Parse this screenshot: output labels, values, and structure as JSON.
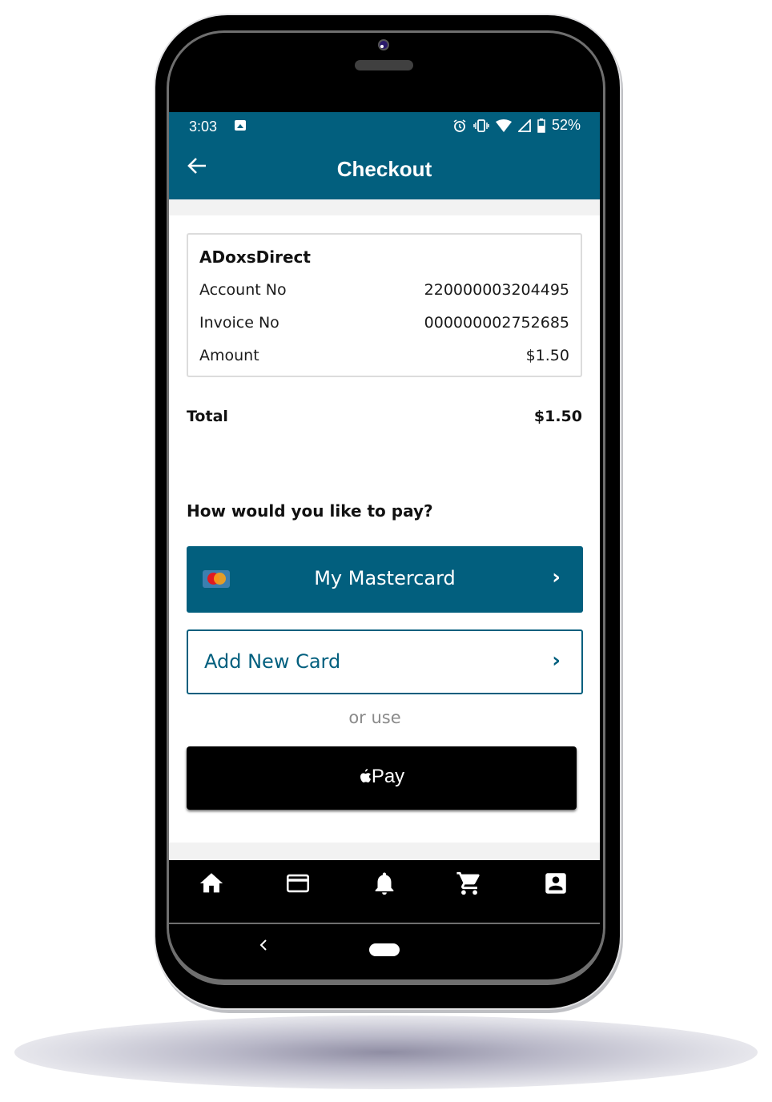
{
  "status_bar": {
    "time": "3:03",
    "battery": "52%",
    "icons": [
      "image-icon",
      "alarm-icon",
      "vibrate-icon",
      "wifi-icon",
      "signal-icon",
      "battery-icon"
    ]
  },
  "app_bar": {
    "title": "Checkout",
    "back_icon": "arrow-left-icon"
  },
  "invoice_card": {
    "merchant": "ADoxsDirect",
    "rows": [
      {
        "label": "Account No",
        "value": "220000003204495"
      },
      {
        "label": "Invoice No",
        "value": "000000002752685"
      },
      {
        "label": "Amount",
        "value": "$1.50"
      }
    ]
  },
  "total": {
    "label": "Total",
    "value": "$1.50"
  },
  "payment": {
    "question": "How would you like to pay?",
    "saved_card": {
      "label": "My Mastercard",
      "icon": "mastercard-icon"
    },
    "add_card": {
      "label": "Add New Card"
    },
    "or_use": "or use",
    "apple_pay": {
      "label": "Pay",
      "text": "Pay"
    }
  },
  "bottom_nav": {
    "items": [
      {
        "name": "home",
        "icon": "home-icon"
      },
      {
        "name": "cards",
        "icon": "credit-card-icon"
      },
      {
        "name": "notifications",
        "icon": "bell-icon"
      },
      {
        "name": "cart",
        "icon": "cart-icon"
      },
      {
        "name": "account",
        "icon": "account-box-icon"
      }
    ]
  },
  "colors": {
    "primary": "#025f7e",
    "background": "#ffffff",
    "nav_background": "#000000"
  }
}
